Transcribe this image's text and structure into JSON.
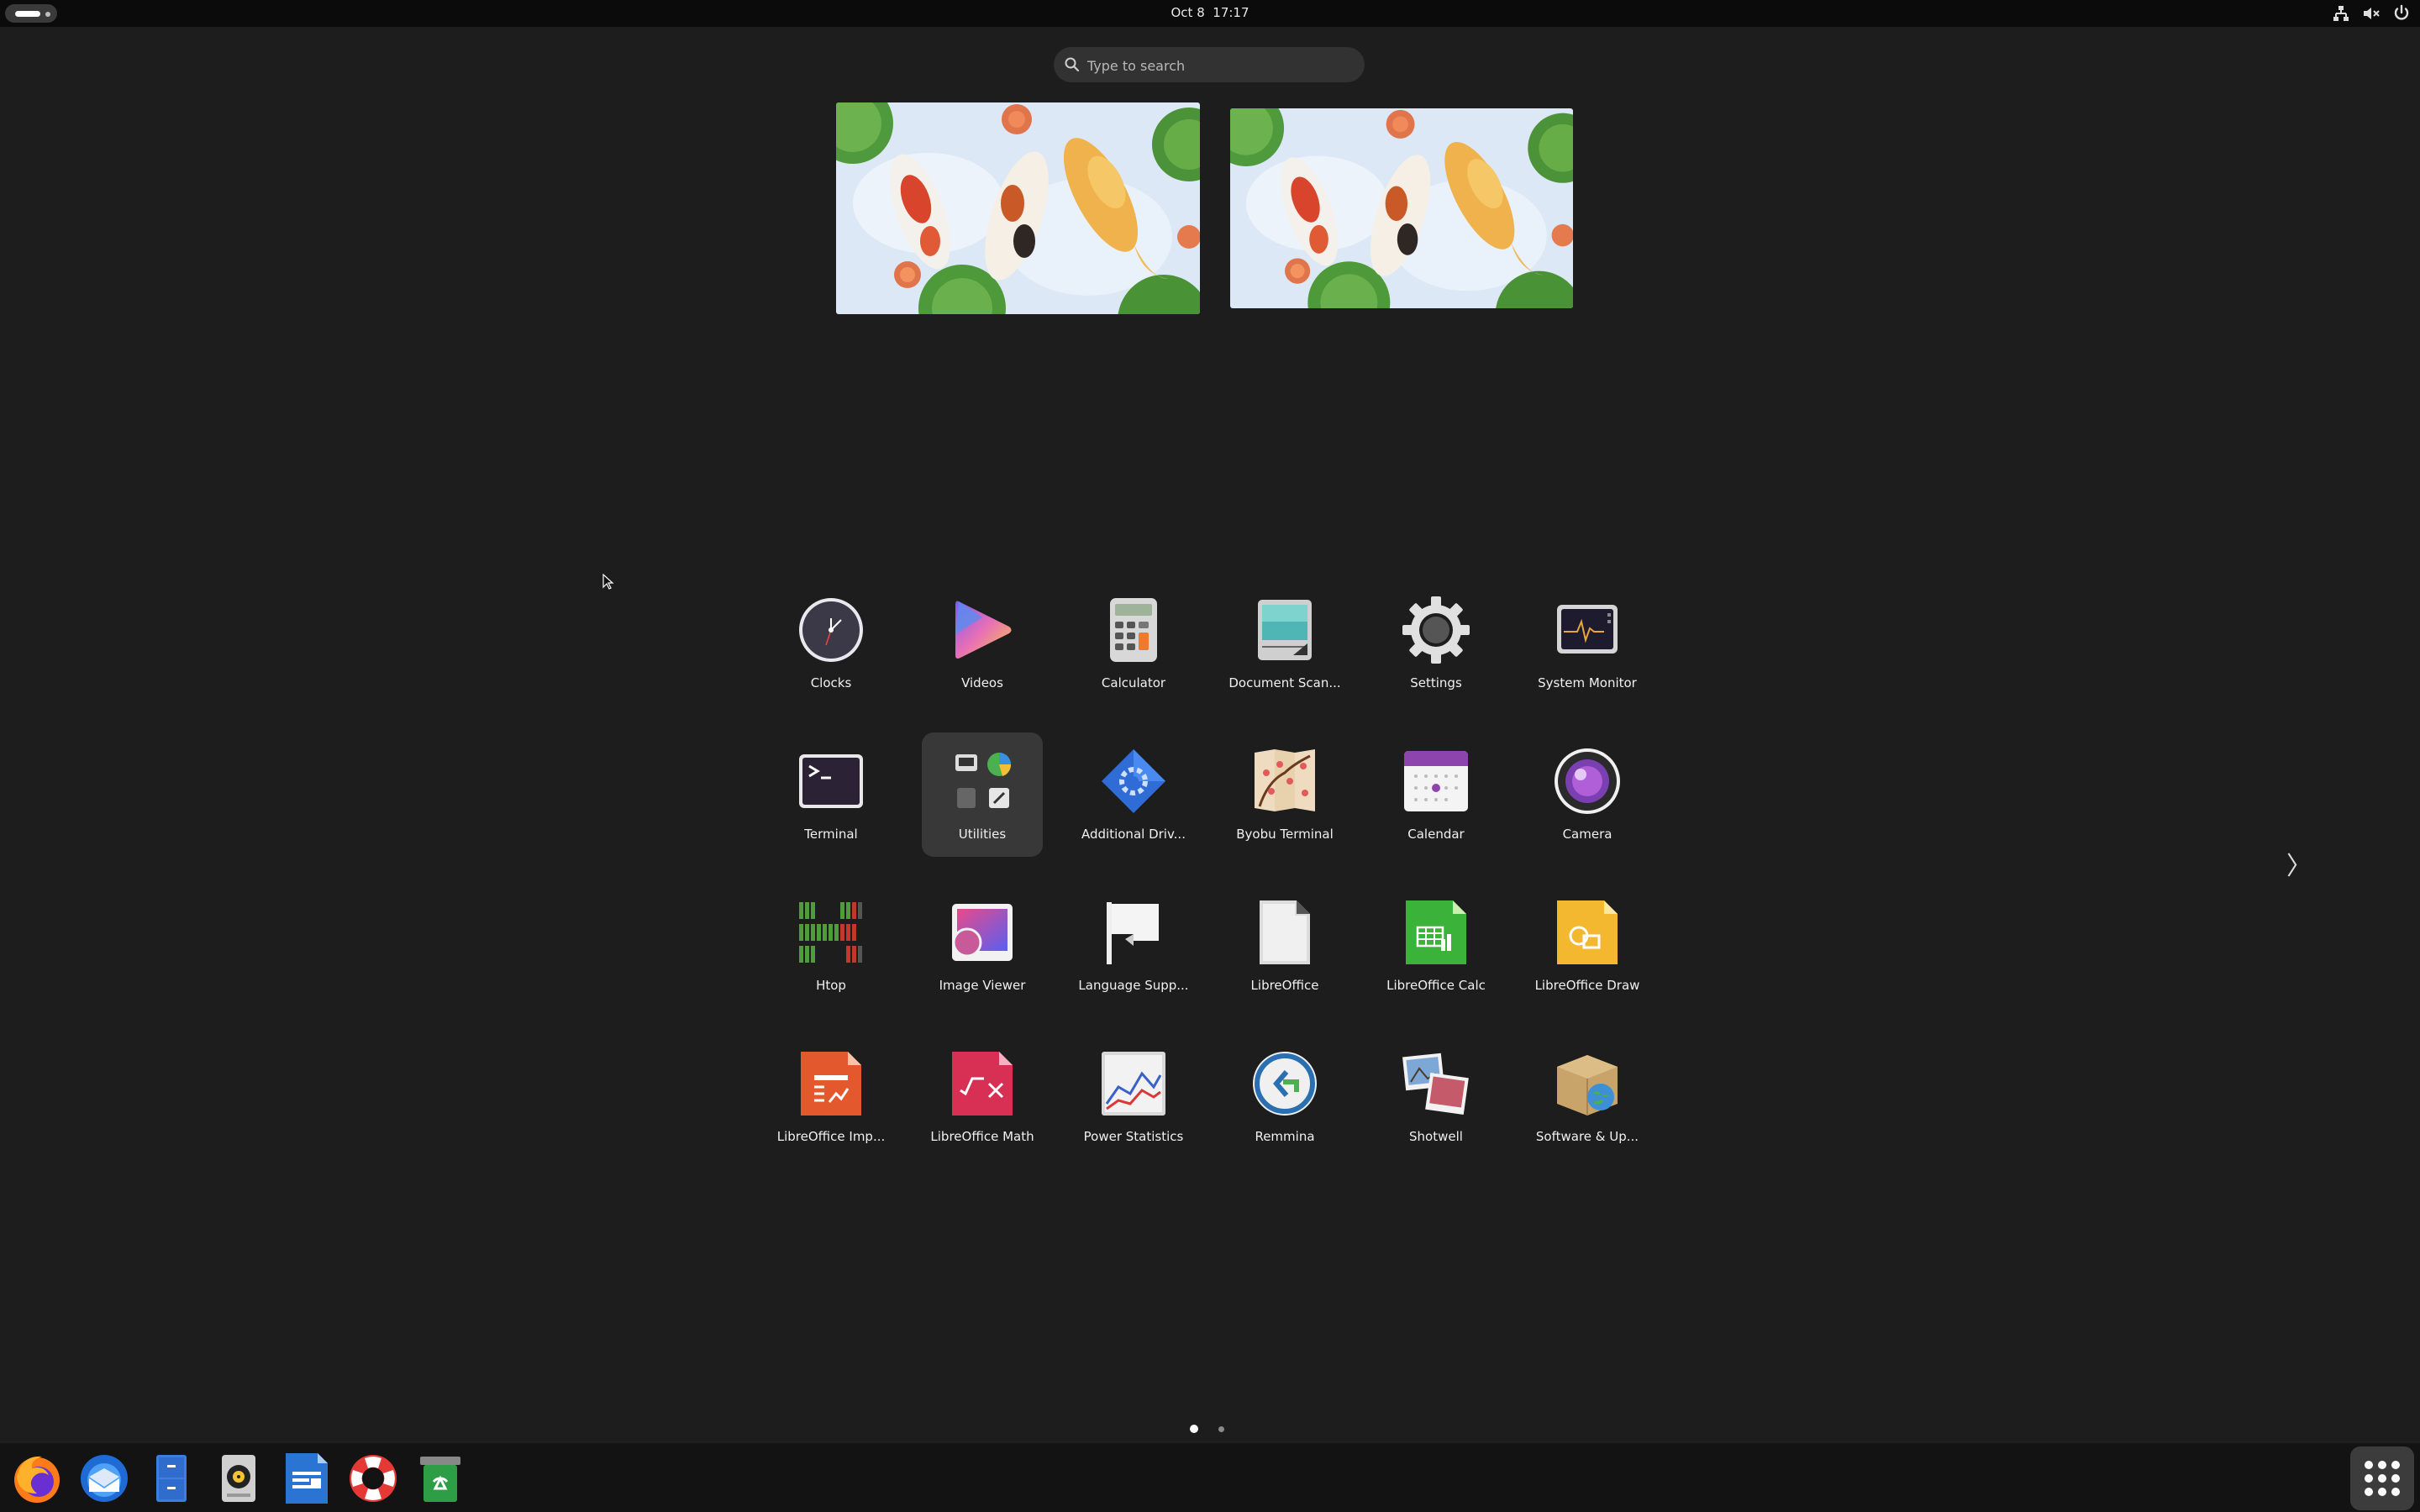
{
  "topbar": {
    "date": "Oct 8",
    "time": "17:17",
    "tray_icons": [
      "network-icon",
      "volume-muted-icon",
      "power-icon"
    ]
  },
  "search": {
    "placeholder": "Type to search"
  },
  "workspaces": [
    "koi-wallpaper",
    "koi-wallpaper"
  ],
  "apps": {
    "clocks": "Clocks",
    "videos": "Videos",
    "calculator": "Calculator",
    "document_scanner": "Document Scan...",
    "settings": "Settings",
    "system_monitor": "System Monitor",
    "terminal": "Terminal",
    "utilities": "Utilities",
    "additional_drivers": "Additional Driv...",
    "byobu": "Byobu Terminal",
    "calendar": "Calendar",
    "camera": "Camera",
    "htop": "Htop",
    "image_viewer": "Image Viewer",
    "language_support": "Language Supp...",
    "libreoffice": "LibreOffice",
    "lo_calc": "LibreOffice Calc",
    "lo_draw": "LibreOffice Draw",
    "lo_impress": "LibreOffice Imp...",
    "lo_math": "LibreOffice Math",
    "power_statistics": "Power Statistics",
    "remmina": "Remmina",
    "shotwell": "Shotwell",
    "software_updates": "Software & Up..."
  },
  "pager": {
    "pages": 2,
    "current": 1,
    "next_arrow": "〉"
  },
  "dock": [
    "Firefox",
    "Thunderbird",
    "Files",
    "Rhythmbox",
    "LibreOffice Writer",
    "Help",
    "Trash"
  ],
  "colors": {
    "background": "#1d1d1d",
    "topbar": "#0b0b0b",
    "dock": "#131313",
    "accent_purple": "#8e44ad"
  }
}
